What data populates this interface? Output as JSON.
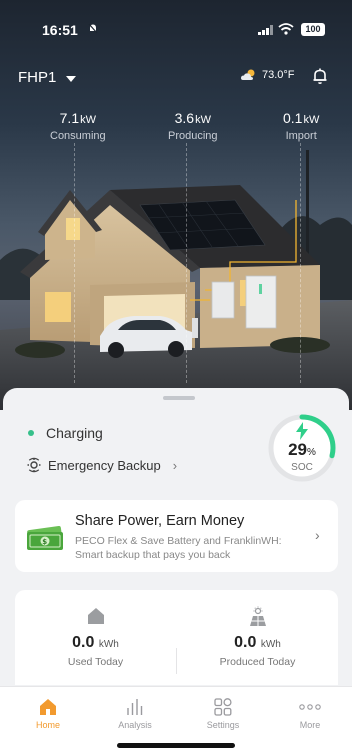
{
  "status_bar": {
    "time": "16:51",
    "battery": "100"
  },
  "header": {
    "site_name": "FHP1",
    "temperature": "73.0°F"
  },
  "metrics": [
    {
      "value": "7.1",
      "unit": "kW",
      "label": "Consuming"
    },
    {
      "value": "3.6",
      "unit": "kW",
      "label": "Producing"
    },
    {
      "value": "0.1",
      "unit": "kW",
      "label": "Import"
    }
  ],
  "battery": {
    "status": "Charging",
    "mode": "Emergency Backup",
    "soc_value": "29",
    "soc_unit": "%",
    "soc_label": "SOC",
    "soc_fraction": 0.29
  },
  "promo": {
    "title": "Share Power, Earn Money",
    "subtitle": "PECO Flex & Save Battery and FranklinWH: Smart backup that pays you back"
  },
  "energy": {
    "used": {
      "value": "0.0",
      "unit": "kWh",
      "label": "Used Today"
    },
    "produced": {
      "value": "0.0",
      "unit": "kWh",
      "label": "Produced Today"
    }
  },
  "tabs": [
    {
      "label": "Home",
      "active": true
    },
    {
      "label": "Analysis",
      "active": false
    },
    {
      "label": "Settings",
      "active": false
    },
    {
      "label": "More",
      "active": false
    }
  ],
  "colors": {
    "accent": "#f29a2e",
    "soc_ring": "#2fcf8a",
    "status_dot": "#36c08a"
  }
}
